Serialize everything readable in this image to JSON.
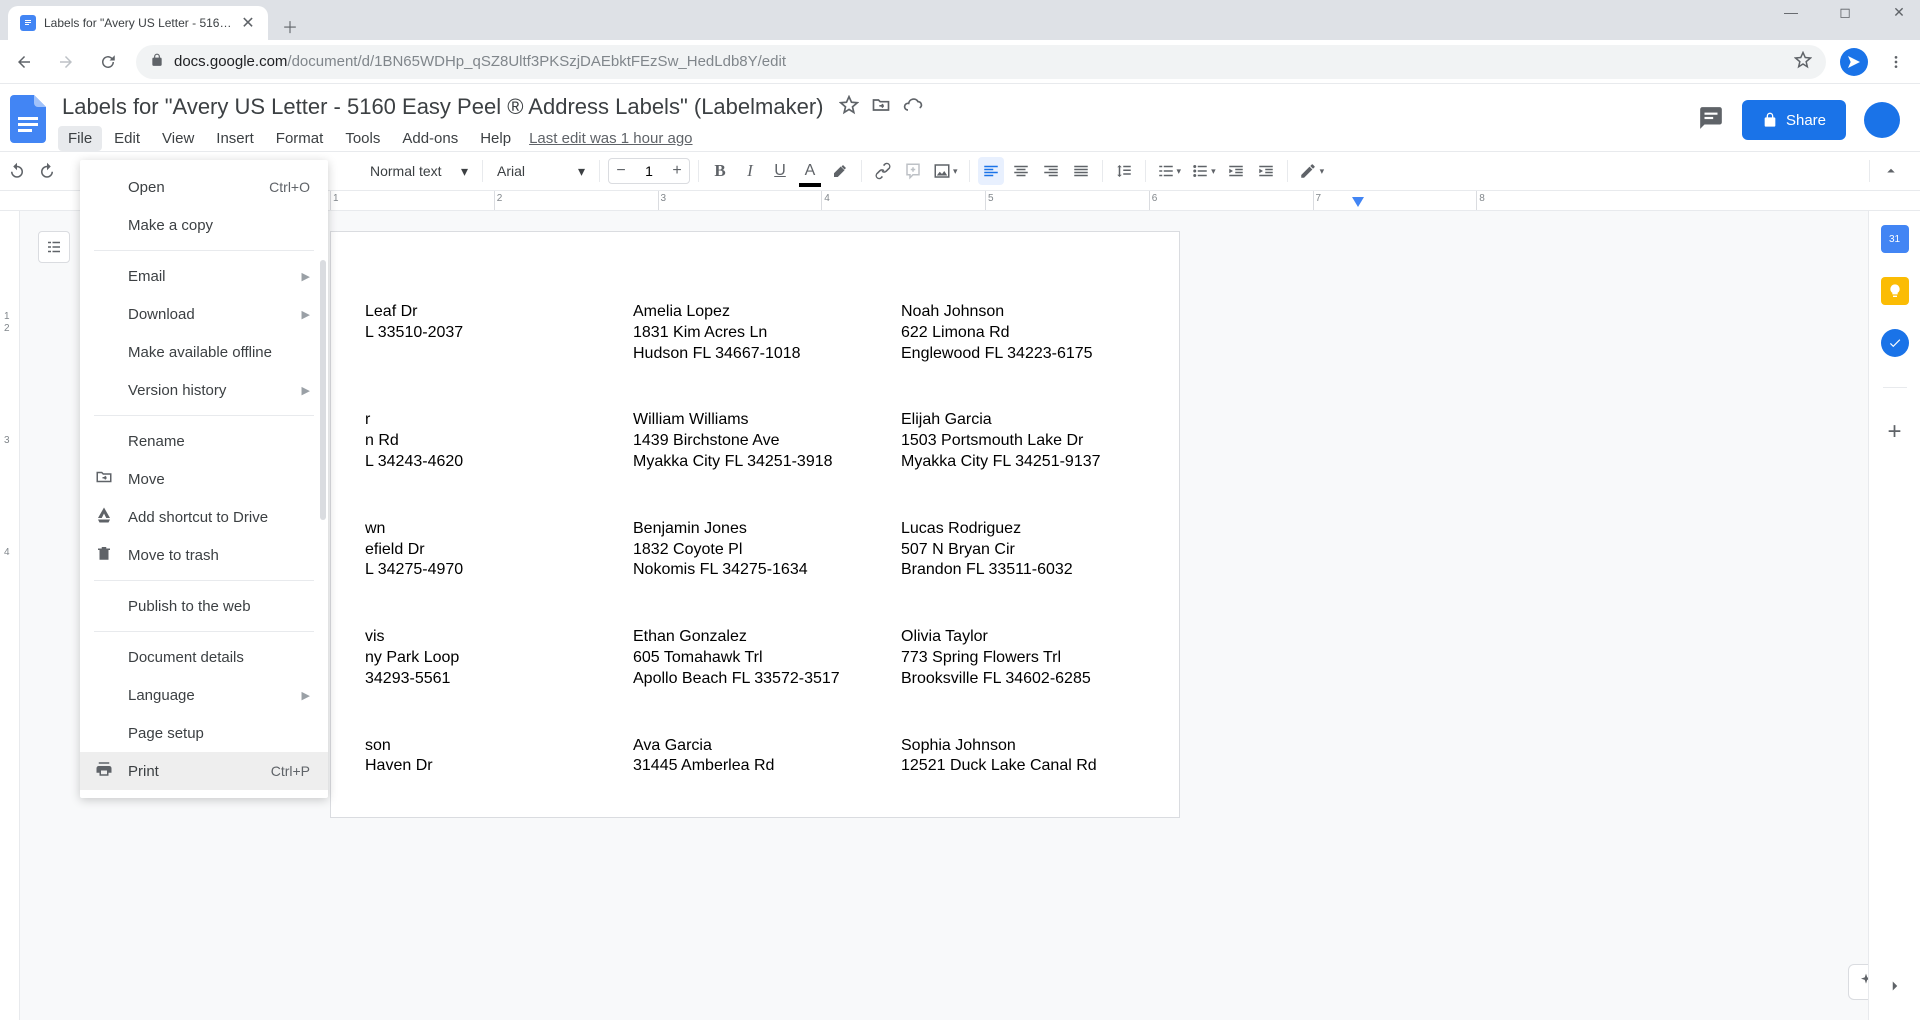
{
  "browser": {
    "tab_title": "Labels for \"Avery US Letter - 516…",
    "url_host": "docs.google.com",
    "url_path": "/document/d/1BN65WDHp_qSZ8Ultf3PKSzjDAEbktFEzSw_HedLdb8Y/edit"
  },
  "docs": {
    "title": "Labels for \"Avery US Letter - 5160 Easy Peel ® Address Labels\" (Labelmaker)",
    "last_edit": "Last edit was 1 hour ago",
    "menus": {
      "file": "File",
      "edit": "Edit",
      "view": "View",
      "insert": "Insert",
      "format": "Format",
      "tools": "Tools",
      "addons": "Add-ons",
      "help": "Help"
    },
    "share": "Share"
  },
  "toolbar": {
    "style": "Normal text",
    "font": "Arial",
    "size": "1"
  },
  "ruler": {
    "marks": [
      "1",
      "2",
      "3",
      "4",
      "5",
      "6",
      "7",
      "8"
    ]
  },
  "file_menu": {
    "open": "Open",
    "open_hint": "Ctrl+O",
    "make_copy": "Make a copy",
    "email": "Email",
    "download": "Download",
    "offline": "Make available offline",
    "version": "Version history",
    "rename": "Rename",
    "move": "Move",
    "shortcut": "Add shortcut to Drive",
    "trash": "Move to trash",
    "publish": "Publish to the web",
    "details": "Document details",
    "language": "Language",
    "page_setup": "Page setup",
    "print": "Print",
    "print_hint": "Ctrl+P"
  },
  "sidecol": {
    "cal": "31"
  },
  "vruler": [
    "1",
    "2",
    "3",
    "4"
  ],
  "labels": [
    [
      {
        "name": "",
        "addr": " Leaf Dr",
        "csz": "L 33510-2037"
      },
      {
        "name": "Amelia Lopez",
        "addr": "1831 Kim Acres Ln",
        "csz": "Hudson FL 34667-1018"
      },
      {
        "name": "Noah Johnson",
        "addr": "622 Limona Rd",
        "csz": "Englewood FL 34223-6175"
      }
    ],
    [
      {
        "name": "r",
        "addr": "n Rd",
        "csz": "L 34243-4620"
      },
      {
        "name": "William Williams",
        "addr": "1439 Birchstone Ave",
        "csz": "Myakka City FL 34251-3918"
      },
      {
        "name": "Elijah Garcia",
        "addr": "1503 Portsmouth Lake Dr",
        "csz": "Myakka City FL 34251-9137"
      }
    ],
    [
      {
        "name": "wn",
        "addr": "efield Dr",
        "csz": "L 34275-4970"
      },
      {
        "name": "Benjamin Jones",
        "addr": "1832 Coyote Pl",
        "csz": "Nokomis FL 34275-1634"
      },
      {
        "name": "Lucas Rodriguez",
        "addr": "507 N Bryan Cir",
        "csz": "Brandon FL 33511-6032"
      }
    ],
    [
      {
        "name": "vis",
        "addr": "ny Park Loop",
        "csz": "34293-5561"
      },
      {
        "name": "Ethan Gonzalez",
        "addr": "605 Tomahawk Trl",
        "csz": "Apollo Beach FL 33572-3517"
      },
      {
        "name": "Olivia Taylor",
        "addr": "773 Spring Flowers Trl",
        "csz": "Brooksville FL 34602-6285"
      }
    ],
    [
      {
        "name": "son",
        "addr": "Haven Dr",
        "csz": ""
      },
      {
        "name": "Ava Garcia",
        "addr": "31445 Amberlea Rd",
        "csz": ""
      },
      {
        "name": "Sophia Johnson",
        "addr": "12521 Duck Lake Canal Rd",
        "csz": ""
      }
    ]
  ]
}
